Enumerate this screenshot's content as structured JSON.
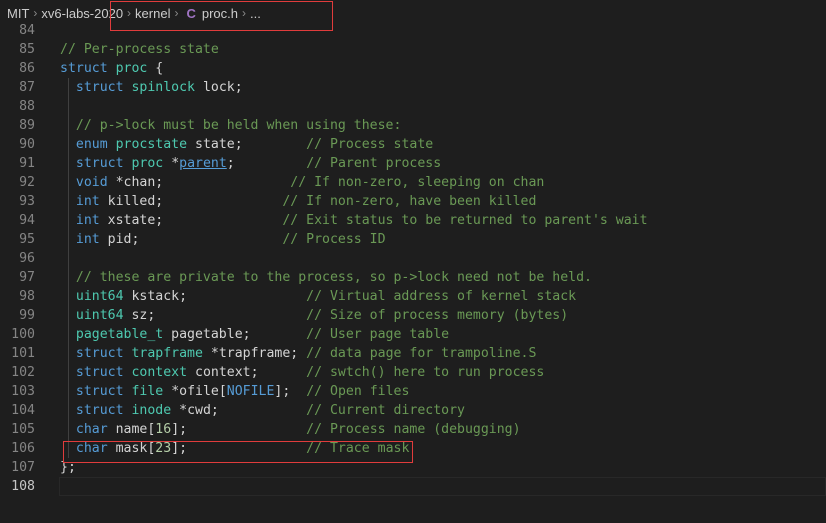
{
  "breadcrumb": {
    "items": [
      "MIT",
      "xv6-labs-2020",
      "kernel",
      "proc.h",
      "..."
    ],
    "file_icon": "C"
  },
  "editor": {
    "lines": [
      {
        "n": "84",
        "tokens": []
      },
      {
        "n": "85",
        "tokens": [
          {
            "t": "// Per-process state",
            "c": "cm"
          }
        ]
      },
      {
        "n": "86",
        "tokens": [
          {
            "t": "struct",
            "c": "kw"
          },
          {
            "t": " "
          },
          {
            "t": "proc",
            "c": "ty"
          },
          {
            "t": " {"
          }
        ]
      },
      {
        "n": "87",
        "tokens": [
          {
            "t": "  "
          },
          {
            "t": "struct",
            "c": "kw"
          },
          {
            "t": " "
          },
          {
            "t": "spinlock",
            "c": "ty"
          },
          {
            "t": " lock;"
          }
        ]
      },
      {
        "n": "88",
        "tokens": []
      },
      {
        "n": "89",
        "tokens": [
          {
            "t": "  "
          },
          {
            "t": "// p->lock must be held when using these:",
            "c": "cm"
          }
        ]
      },
      {
        "n": "90",
        "tokens": [
          {
            "t": "  "
          },
          {
            "t": "enum",
            "c": "kw"
          },
          {
            "t": " "
          },
          {
            "t": "procstate",
            "c": "ty"
          },
          {
            "t": " state;        "
          },
          {
            "t": "// Process state",
            "c": "cm"
          }
        ]
      },
      {
        "n": "91",
        "tokens": [
          {
            "t": "  "
          },
          {
            "t": "struct",
            "c": "kw"
          },
          {
            "t": " "
          },
          {
            "t": "proc",
            "c": "ty"
          },
          {
            "t": " *"
          },
          {
            "t": "parent",
            "c": "link"
          },
          {
            "t": ";         "
          },
          {
            "t": "// Parent process",
            "c": "cm"
          }
        ]
      },
      {
        "n": "92",
        "tokens": [
          {
            "t": "  "
          },
          {
            "t": "void",
            "c": "kw"
          },
          {
            "t": " *chan;                "
          },
          {
            "t": "// If non-zero, sleeping on chan",
            "c": "cm"
          }
        ]
      },
      {
        "n": "93",
        "tokens": [
          {
            "t": "  "
          },
          {
            "t": "int",
            "c": "kw"
          },
          {
            "t": " killed;               "
          },
          {
            "t": "// If non-zero, have been killed",
            "c": "cm"
          }
        ]
      },
      {
        "n": "94",
        "tokens": [
          {
            "t": "  "
          },
          {
            "t": "int",
            "c": "kw"
          },
          {
            "t": " xstate;               "
          },
          {
            "t": "// Exit status to be returned to parent's wait",
            "c": "cm"
          }
        ]
      },
      {
        "n": "95",
        "tokens": [
          {
            "t": "  "
          },
          {
            "t": "int",
            "c": "kw"
          },
          {
            "t": " pid;                  "
          },
          {
            "t": "// Process ID",
            "c": "cm"
          }
        ]
      },
      {
        "n": "96",
        "tokens": []
      },
      {
        "n": "97",
        "tokens": [
          {
            "t": "  "
          },
          {
            "t": "// these are private to the process, so p->lock need not be held.",
            "c": "cm"
          }
        ]
      },
      {
        "n": "98",
        "tokens": [
          {
            "t": "  "
          },
          {
            "t": "uint64",
            "c": "ty"
          },
          {
            "t": " kstack;               "
          },
          {
            "t": "// Virtual address of kernel stack",
            "c": "cm"
          }
        ]
      },
      {
        "n": "99",
        "tokens": [
          {
            "t": "  "
          },
          {
            "t": "uint64",
            "c": "ty"
          },
          {
            "t": " sz;                   "
          },
          {
            "t": "// Size of process memory (bytes)",
            "c": "cm"
          }
        ]
      },
      {
        "n": "100",
        "tokens": [
          {
            "t": "  "
          },
          {
            "t": "pagetable_t",
            "c": "ty"
          },
          {
            "t": " pagetable;       "
          },
          {
            "t": "// User page table",
            "c": "cm"
          }
        ]
      },
      {
        "n": "101",
        "tokens": [
          {
            "t": "  "
          },
          {
            "t": "struct",
            "c": "kw"
          },
          {
            "t": " "
          },
          {
            "t": "trapframe",
            "c": "ty"
          },
          {
            "t": " *trapframe; "
          },
          {
            "t": "// data page for trampoline.S",
            "c": "cm"
          }
        ]
      },
      {
        "n": "102",
        "tokens": [
          {
            "t": "  "
          },
          {
            "t": "struct",
            "c": "kw"
          },
          {
            "t": " "
          },
          {
            "t": "context",
            "c": "ty"
          },
          {
            "t": " context;      "
          },
          {
            "t": "// swtch() here to run process",
            "c": "cm"
          }
        ]
      },
      {
        "n": "103",
        "tokens": [
          {
            "t": "  "
          },
          {
            "t": "struct",
            "c": "kw"
          },
          {
            "t": " "
          },
          {
            "t": "file",
            "c": "ty"
          },
          {
            "t": " *ofile["
          },
          {
            "t": "NOFILE",
            "c": "mac"
          },
          {
            "t": "];  "
          },
          {
            "t": "// Open files",
            "c": "cm"
          }
        ]
      },
      {
        "n": "104",
        "tokens": [
          {
            "t": "  "
          },
          {
            "t": "struct",
            "c": "kw"
          },
          {
            "t": " "
          },
          {
            "t": "inode",
            "c": "ty"
          },
          {
            "t": " *cwd;           "
          },
          {
            "t": "// Current directory",
            "c": "cm"
          }
        ]
      },
      {
        "n": "105",
        "tokens": [
          {
            "t": "  "
          },
          {
            "t": "char",
            "c": "kw"
          },
          {
            "t": " name["
          },
          {
            "t": "16",
            "c": "nm"
          },
          {
            "t": "];               "
          },
          {
            "t": "// Process name (debugging)",
            "c": "cm"
          }
        ]
      },
      {
        "n": "106",
        "tokens": [
          {
            "t": "  "
          },
          {
            "t": "char",
            "c": "kw"
          },
          {
            "t": " mask["
          },
          {
            "t": "23",
            "c": "nm"
          },
          {
            "t": "];               "
          },
          {
            "t": "// Trace mask",
            "c": "cm"
          }
        ]
      },
      {
        "n": "107",
        "tokens": [
          {
            "t": "};"
          }
        ]
      },
      {
        "n": "108",
        "tokens": []
      }
    ]
  },
  "colors": {
    "background": "#1e1e1e",
    "keyword": "#569cd6",
    "type": "#4ec9b0",
    "comment": "#6a9955",
    "number": "#b5cea8",
    "highlight_box": "#e03c3c"
  }
}
